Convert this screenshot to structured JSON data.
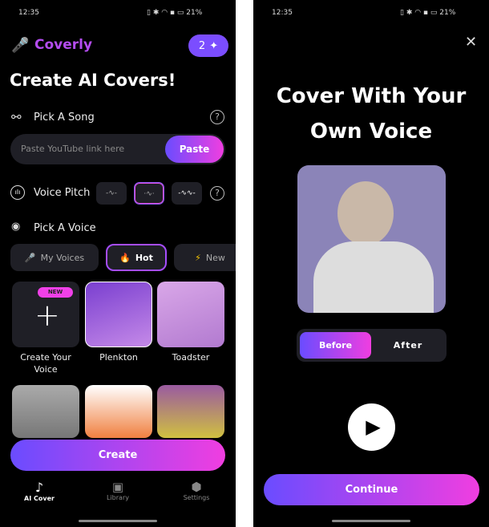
{
  "left": {
    "status": {
      "time": "12:35",
      "battery": "21%"
    },
    "brand": "Coverly",
    "credits": "2",
    "title": "Create AI Covers!",
    "pick_song": "Pick A Song",
    "link_placeholder": "Paste YouTube link here",
    "paste": "Paste",
    "voice_pitch": "Voice Pitch",
    "pitch_selected_index": 1,
    "pick_voice": "Pick A Voice",
    "tabs": [
      {
        "label": "My Voices",
        "icon": "microphone-icon"
      },
      {
        "label": "Hot",
        "icon": "fire-icon",
        "selected": true
      },
      {
        "label": "New",
        "icon": "lightning-icon"
      }
    ],
    "new_badge": "NEW",
    "voices": [
      {
        "label": "Create Your Voice"
      },
      {
        "label": "Plenkton"
      },
      {
        "label": "Toadster"
      }
    ],
    "create": "Create",
    "nav": [
      {
        "label": "AI Cover",
        "active": true
      },
      {
        "label": "Library"
      },
      {
        "label": "Settings"
      }
    ]
  },
  "right": {
    "status": {
      "time": "12:35",
      "battery": "21%"
    },
    "title_line1": "Cover With Your",
    "title_line2": "Own Voice",
    "toggle": {
      "before": "Before",
      "after": "After",
      "selected": "Before"
    },
    "continue": "Continue"
  },
  "colors": {
    "accent_start": "#6a4cff",
    "accent_end": "#f03ee0",
    "brand": "#b44cf0"
  }
}
